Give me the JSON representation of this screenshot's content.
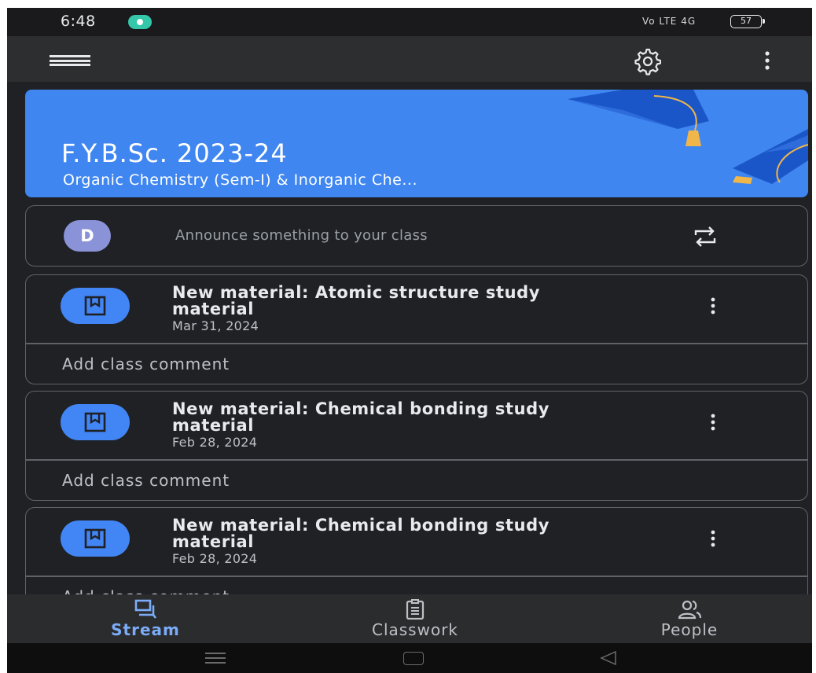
{
  "status_bar": {
    "time": "6:48",
    "network": "Vo LTE 4G",
    "battery": "57"
  },
  "app_bar": {
    "menu_icon": "hamburger-menu-icon",
    "settings_icon": "gear-icon",
    "more_icon": "more-vert-icon"
  },
  "banner": {
    "title": "F.Y.B.Sc. 2023-24",
    "subtitle": "Organic Chemistry (Sem-I) & Inorganic Che...",
    "color": "#3f86f1"
  },
  "announce": {
    "avatar_letter": "D",
    "placeholder": "Announce something to your class",
    "avatar_color": "#8a93d8"
  },
  "posts": [
    {
      "title": "New material: Atomic structure study material",
      "date": "Mar 31, 2024",
      "comment": "Add class comment"
    },
    {
      "title": "New material: Chemical bonding study material",
      "date": "Feb 28, 2024",
      "comment": "Add class comment"
    },
    {
      "title": "New material: Chemical bonding study material",
      "date": "Feb 28, 2024",
      "comment": "Add class comment"
    }
  ],
  "bottom_nav": {
    "items": [
      {
        "label": "Stream",
        "icon": "stream-icon",
        "active": true
      },
      {
        "label": "Classwork",
        "icon": "classwork-icon",
        "active": false
      },
      {
        "label": "People",
        "icon": "people-icon",
        "active": false
      }
    ],
    "active_color": "#7cacf8"
  },
  "theme": {
    "background": "#202124",
    "accent": "#4285f4"
  }
}
